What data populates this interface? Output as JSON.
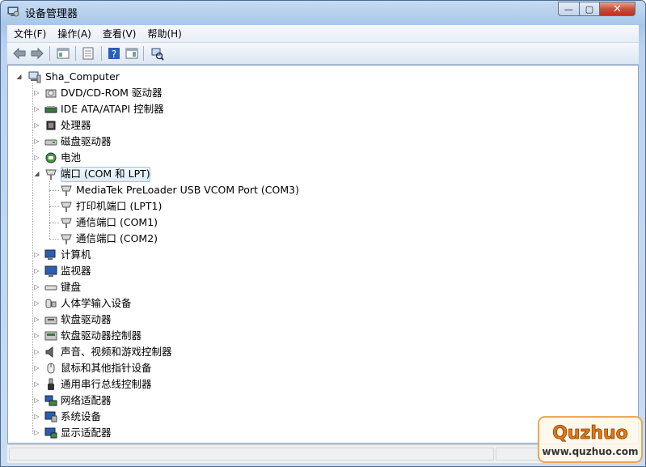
{
  "window": {
    "title": "设备管理器",
    "icon": "device-manager-icon"
  },
  "caption_buttons": {
    "minimize": "—",
    "maximize": "▢",
    "close": "✕"
  },
  "menu": [
    "文件(F)",
    "操作(A)",
    "查看(V)",
    "帮助(H)"
  ],
  "toolbar": [
    "back-arrow-icon",
    "forward-arrow-icon",
    "console-tree-icon",
    "properties-icon",
    "help-icon",
    "action-pane-icon",
    "scan-hardware-icon"
  ],
  "tree": {
    "root": {
      "label": "Sha_Computer",
      "icon": "computer-icon"
    },
    "items": [
      {
        "label": "DVD/CD-ROM 驱动器",
        "icon": "dvd-drive-icon"
      },
      {
        "label": "IDE ATA/ATAPI 控制器",
        "icon": "ide-controller-icon"
      },
      {
        "label": "处理器",
        "icon": "processor-icon"
      },
      {
        "label": "磁盘驱动器",
        "icon": "disk-drive-icon"
      },
      {
        "label": "电池",
        "icon": "battery-icon"
      },
      {
        "label": "端口 (COM 和 LPT)",
        "icon": "port-icon",
        "expanded": true,
        "selected": true,
        "children": [
          {
            "label": "MediaTek PreLoader USB VCOM Port (COM3)",
            "icon": "port-icon"
          },
          {
            "label": "打印机端口 (LPT1)",
            "icon": "port-icon"
          },
          {
            "label": "通信端口 (COM1)",
            "icon": "port-icon"
          },
          {
            "label": "通信端口 (COM2)",
            "icon": "port-icon"
          }
        ]
      },
      {
        "label": "计算机",
        "icon": "computer-monitor-icon"
      },
      {
        "label": "监视器",
        "icon": "monitor-icon"
      },
      {
        "label": "键盘",
        "icon": "keyboard-icon"
      },
      {
        "label": "人体学输入设备",
        "icon": "hid-icon"
      },
      {
        "label": "软盘驱动器",
        "icon": "floppy-drive-icon"
      },
      {
        "label": "软盘驱动器控制器",
        "icon": "floppy-controller-icon"
      },
      {
        "label": "声音、视频和游戏控制器",
        "icon": "speaker-icon"
      },
      {
        "label": "鼠标和其他指针设备",
        "icon": "mouse-icon"
      },
      {
        "label": "通用串行总线控制器",
        "icon": "usb-icon"
      },
      {
        "label": "网络适配器",
        "icon": "network-adapter-icon"
      },
      {
        "label": "系统设备",
        "icon": "system-device-icon"
      },
      {
        "label": "显示适配器",
        "icon": "display-adapter-icon"
      }
    ]
  },
  "watermark": {
    "brand": "Quzhuo",
    "url": "www.quzhuo.com"
  },
  "colors": {
    "selection": "#dcecfb",
    "titlebar": "#bcd3ef",
    "close": "#c9503a",
    "watermark": "#e07a10"
  }
}
